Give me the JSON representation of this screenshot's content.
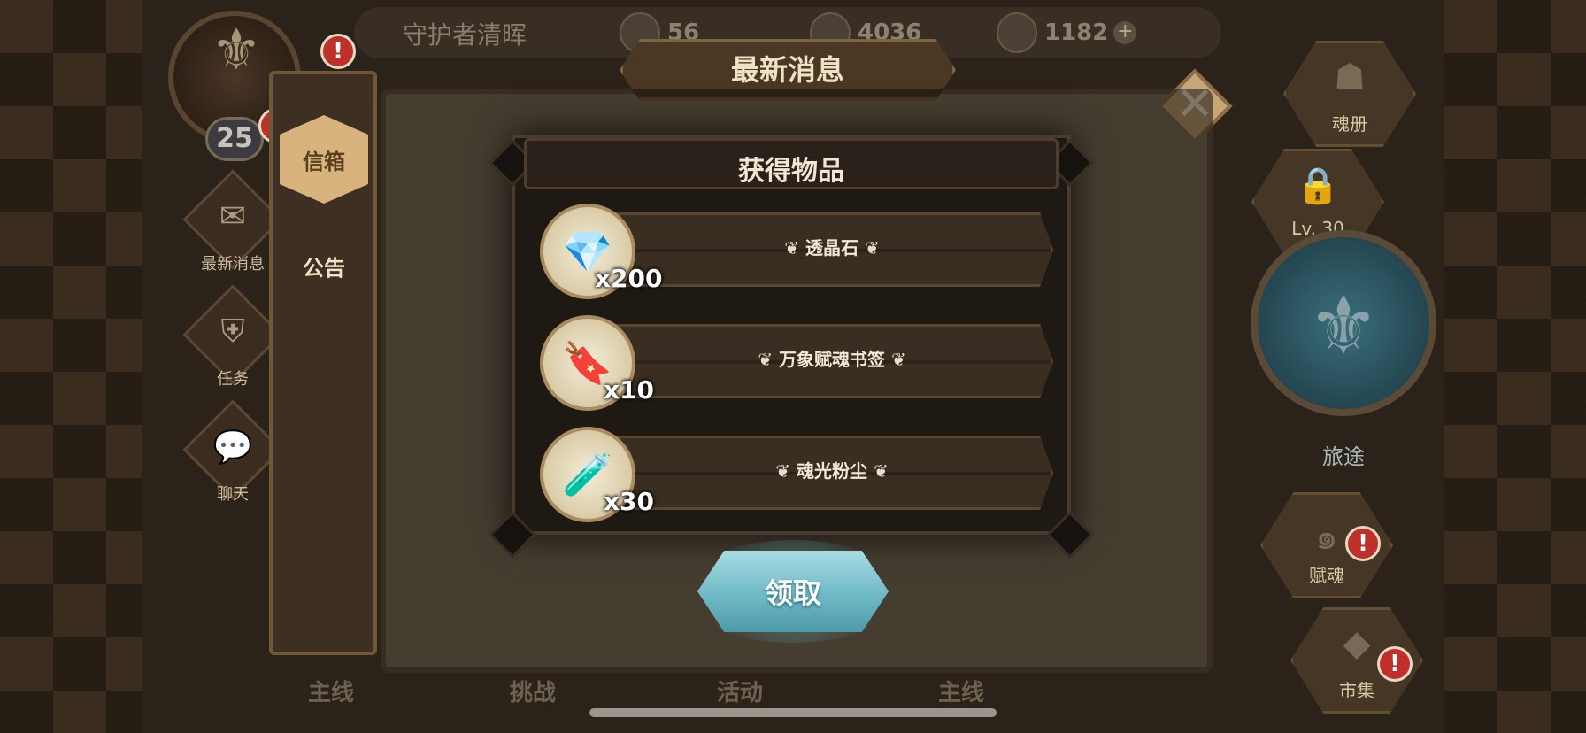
{
  "header": {
    "player_name": "守护者清晖",
    "resources": [
      {
        "icon": "gold-coin-icon",
        "value": "56"
      },
      {
        "icon": "gem-icon",
        "value": "4036"
      },
      {
        "icon": "crystal-icon",
        "value": "1182"
      }
    ],
    "plus_label": "+",
    "level": "25",
    "alert_glyph": "!"
  },
  "left_nav": {
    "items": [
      {
        "label": "最新消息",
        "icon": "cat-mail-icon"
      },
      {
        "label": "任务",
        "icon": "shield-task-icon"
      },
      {
        "label": "聊天",
        "icon": "chat-bubble-icon"
      }
    ]
  },
  "tabs": [
    {
      "label": "信箱",
      "active": true
    },
    {
      "label": "公告",
      "active": false
    }
  ],
  "panel": {
    "title": "最新消息",
    "close_glyph": "✕"
  },
  "right_nav": {
    "items": [
      {
        "label": "魂册",
        "icon": "book-icon"
      },
      {
        "label": "Lv. 30",
        "icon": "lock-icon"
      },
      {
        "label": "赋魂",
        "icon": "spiral-icon"
      },
      {
        "label": "市集",
        "icon": "diamond-market-icon"
      }
    ],
    "journey_label": "旅途"
  },
  "bottom_tabs": [
    "主线",
    "挑战",
    "活动",
    "主线"
  ],
  "reward_modal": {
    "title": "获得物品",
    "items": [
      {
        "name": "透晶石",
        "qty": "x200",
        "icon": "crystal-gem-icon",
        "glyph": "💎"
      },
      {
        "name": "万象赋魂书签",
        "qty": "x10",
        "icon": "bookmark-icon",
        "glyph": "🔖"
      },
      {
        "name": "魂光粉尘",
        "qty": "x30",
        "icon": "dust-bottle-icon",
        "glyph": "🧪"
      }
    ],
    "claim_label": "领取"
  }
}
